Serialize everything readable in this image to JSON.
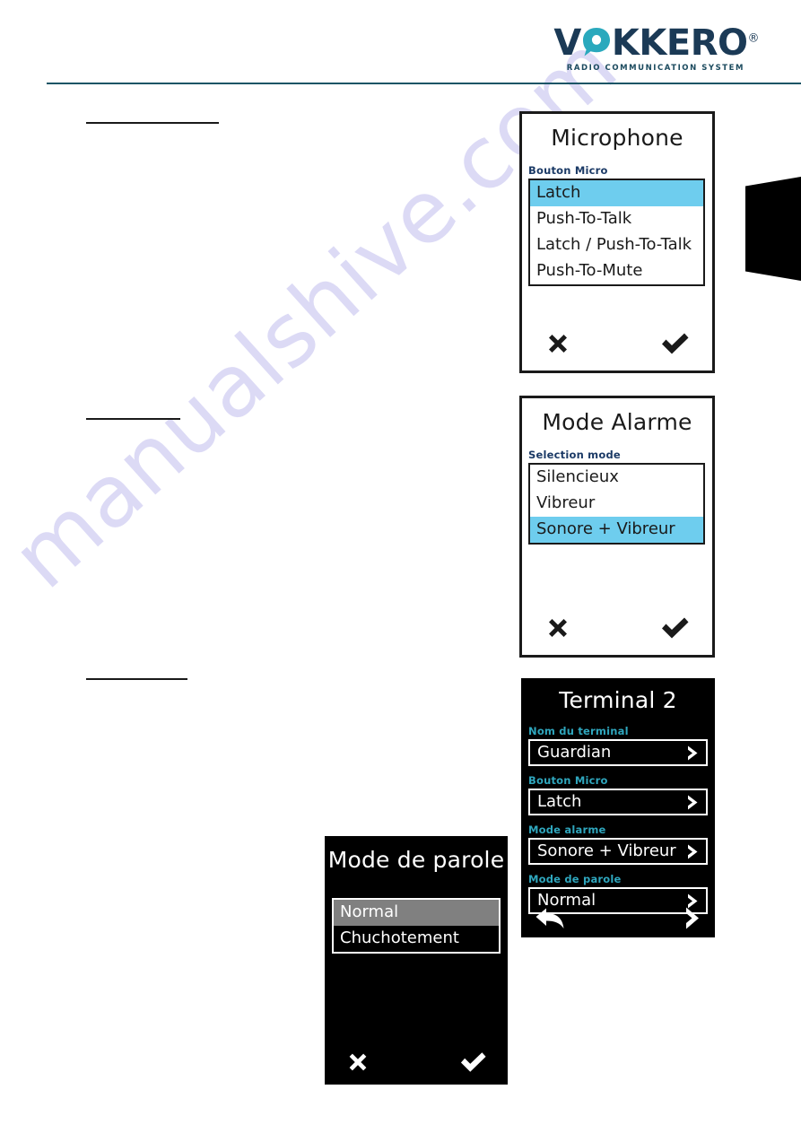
{
  "brand": {
    "name_part1": "V",
    "name_o": "O",
    "name_part2": "KKERO",
    "registered": "®",
    "tagline": "RADIO COMMUNICATION SYSTEM",
    "logo_navy": "#1b3a56",
    "logo_teal": "#2aa9bd",
    "rule_color": "#1b5566"
  },
  "watermark": {
    "text": "manualshive.com",
    "color": "#cfcdf2"
  },
  "page": {
    "redaction_rules": [
      {
        "label": "rule-1"
      },
      {
        "label": "rule-2"
      },
      {
        "label": "rule-3"
      }
    ],
    "edge_tab_color": "#000000"
  },
  "screens": {
    "microphone": {
      "title": "Microphone",
      "field_label": "Bouton Micro",
      "options": [
        {
          "label": "Latch",
          "selected": true
        },
        {
          "label": "Push-To-Talk",
          "selected": false
        },
        {
          "label": "Latch / Push-To-Talk",
          "selected": false
        },
        {
          "label": "Push-To-Mute",
          "selected": false
        }
      ],
      "footer": {
        "cancel_icon": "cross-icon",
        "confirm_icon": "check-icon"
      },
      "highlight_color": "#6ecdee"
    },
    "mode_alarme": {
      "title": "Mode Alarme",
      "field_label": "Selection mode",
      "options": [
        {
          "label": "Silencieux",
          "selected": false
        },
        {
          "label": "Vibreur",
          "selected": false
        },
        {
          "label": "Sonore + Vibreur",
          "selected": true
        }
      ],
      "footer": {
        "cancel_icon": "cross-icon",
        "confirm_icon": "check-icon"
      },
      "highlight_color": "#6ecdee"
    },
    "terminal2": {
      "title": "Terminal 2",
      "fields": [
        {
          "label": "Nom du terminal",
          "value": "Guardian",
          "chevron_icon": "chevron-right-icon"
        },
        {
          "label": "Bouton Micro",
          "value": "Latch",
          "chevron_icon": "chevron-right-icon"
        },
        {
          "label": "Mode alarme",
          "value": "Sonore + Vibreur",
          "chevron_icon": "chevron-right-icon"
        },
        {
          "label": "Mode de parole",
          "value": "Normal",
          "chevron_icon": "chevron-right-icon"
        }
      ],
      "footer": {
        "back_icon": "back-arrow-icon",
        "next_icon": "chevron-right-icon"
      },
      "label_color": "#2fa6bd"
    },
    "mode_parole": {
      "title": "Mode de parole",
      "options": [
        {
          "label": "Normal",
          "selected": true
        },
        {
          "label": "Chuchotement",
          "selected": false
        }
      ],
      "footer": {
        "cancel_icon": "cross-icon",
        "confirm_icon": "check-icon"
      },
      "highlight_color": "#808080"
    }
  }
}
